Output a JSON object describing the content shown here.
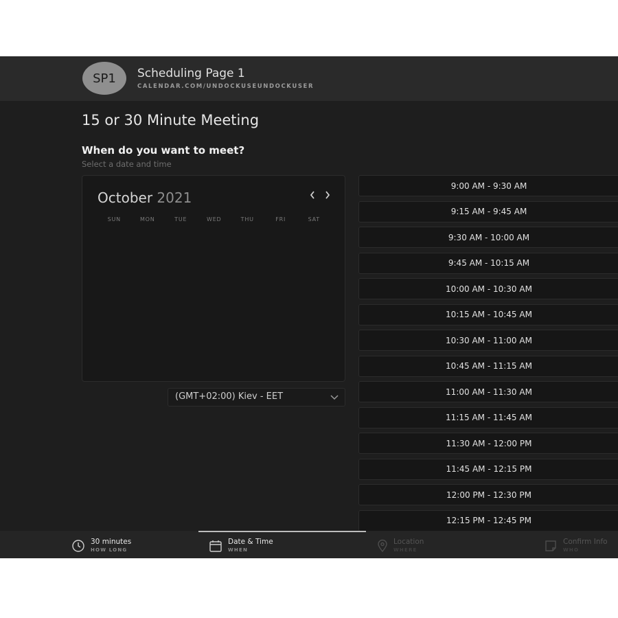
{
  "header": {
    "avatar_initials": "SP1",
    "title": "Scheduling Page 1",
    "url": "CALENDAR.COM/UNDOCKUSEUNDOCKUSER"
  },
  "meeting": {
    "title": "15 or 30 Minute Meeting",
    "section_title": "When do you want to meet?",
    "section_subtitle": "Select a date and time"
  },
  "calendar": {
    "month": "October",
    "year": "2021",
    "prev_icon": "chevron-left-icon",
    "next_icon": "chevron-right-icon",
    "weekdays": [
      "SUN",
      "MON",
      "TUE",
      "WED",
      "THU",
      "FRI",
      "SAT"
    ]
  },
  "timezone": {
    "value": "(GMT+02:00) Kiev - EET",
    "icon": "chevron-down-icon"
  },
  "time_slots": [
    "9:00 AM - 9:30 AM",
    "9:15 AM - 9:45 AM",
    "9:30 AM - 10:00 AM",
    "9:45 AM - 10:15 AM",
    "10:00 AM - 10:30 AM",
    "10:15 AM - 10:45 AM",
    "10:30 AM - 11:00 AM",
    "10:45 AM - 11:15 AM",
    "11:00 AM - 11:30 AM",
    "11:15 AM - 11:45 AM",
    "11:30 AM - 12:00 PM",
    "11:45 AM - 12:15 PM",
    "12:00 PM - 12:30 PM",
    "12:15 PM - 12:45 PM"
  ],
  "steps": [
    {
      "label": "30 minutes",
      "sublabel": "HOW LONG",
      "icon": "clock-icon",
      "state": "done"
    },
    {
      "label": "Date & Time",
      "sublabel": "WHEN",
      "icon": "calendar-icon",
      "state": "active"
    },
    {
      "label": "Location",
      "sublabel": "WHERE",
      "icon": "map-pin-icon",
      "state": "inactive"
    },
    {
      "label": "Confirm Info",
      "sublabel": "WHO",
      "icon": "note-icon",
      "state": "inactive"
    }
  ],
  "colors": {
    "background": "#1e1e1e",
    "header": "#2a2a2a",
    "slot_border": "#2c2c2c",
    "active_step": "#bdbdbd"
  }
}
